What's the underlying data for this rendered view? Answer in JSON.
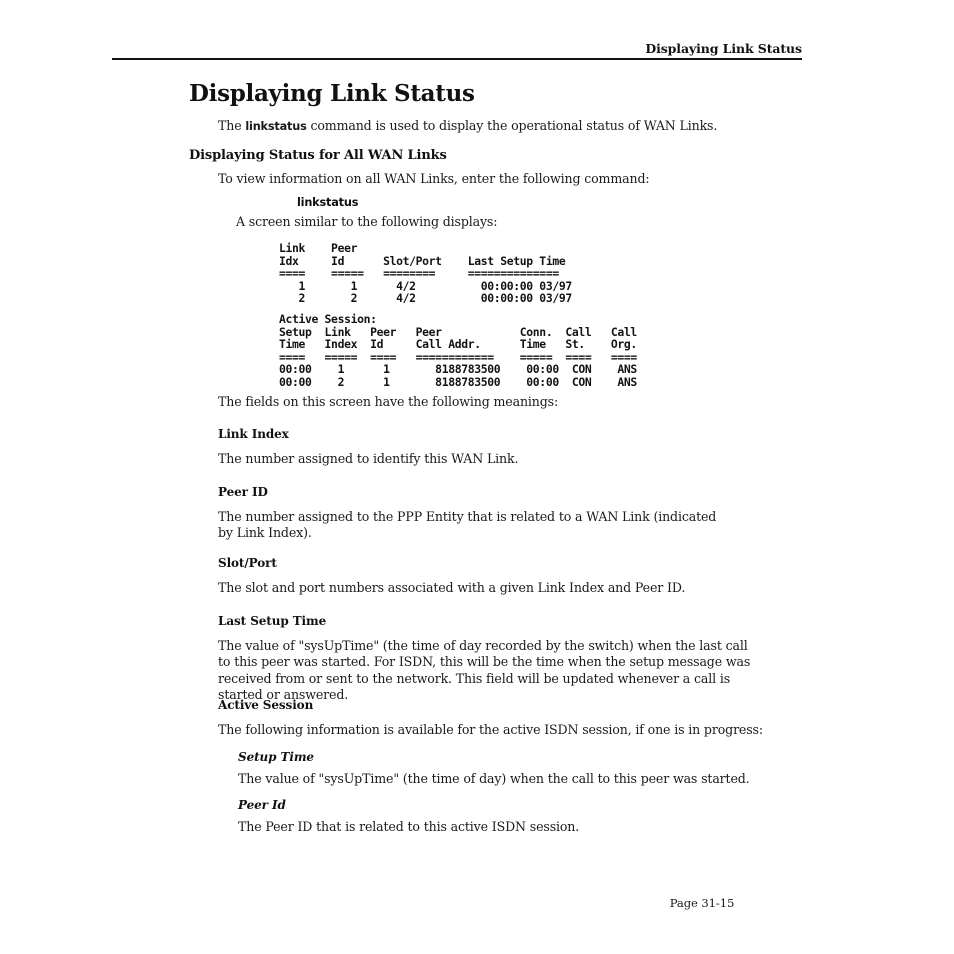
{
  "header": {
    "running_title": "Displaying Link Status"
  },
  "footer": {
    "page_number": "Page 31-15"
  },
  "main": {
    "title": "Displaying Link Status",
    "intro_before_code": "The ",
    "intro_code": "linkstatus",
    "intro_after_code": " command is used to display the operational status of WAN Links.",
    "section_all_links": {
      "heading": "Displaying Status for All WAN Links",
      "instruction": "To view information on all WAN Links, enter the following command:",
      "command": "linkstatus",
      "screen_lead_in": "A screen similar to the following displays:",
      "after_screen": "The fields on this screen have the following meanings:"
    },
    "screen_links_table": {
      "header_line_1": "Link    Peer",
      "header_line_2": "Idx     Id      Slot/Port    Last Setup Time",
      "separator": "====    =====   ========     ==============",
      "rows": [
        "   1       1      4/2          00:00:00 03/97",
        "   2       2      4/2          00:00:00 03/97"
      ]
    },
    "screen_active_session": {
      "label": "Active Session:",
      "header_line_1": "Setup  Link   Peer   Peer            Conn.  Call   Call",
      "header_line_2": "Time   Index  Id     Call Addr.      Time   St.    Org.",
      "separator": "====   =====  ====   ============    =====  ====   ====",
      "rows": [
        "00:00    1      1       8188783500    00:00  CON    ANS",
        "00:00    2      1       8188783500    00:00  CON    ANS"
      ]
    },
    "definitions": [
      {
        "term": "Link Index",
        "text": "The number assigned to identify this WAN Link."
      },
      {
        "term": "Peer ID",
        "text": "The number assigned to the PPP Entity that is related to a WAN Link (indicated by Link Index)."
      },
      {
        "term": "Slot/Port",
        "text": "The slot and port numbers associated with a given Link Index and Peer ID."
      },
      {
        "term": "Last Setup Time",
        "text": "The value of \"sysUpTime\" (the time of day recorded by the switch) when the last call to this peer was started. For ISDN, this will be the time when the setup message was received from or sent to the network. This field will be updated whenever a call is started or answered."
      },
      {
        "term": "Active Session",
        "text": "The following information is available for the active ISDN session, if one is in progress:"
      }
    ],
    "sub_definitions": [
      {
        "term": "Setup Time",
        "text": "The value of \"sysUpTime\" (the time of day) when the call to this peer was started."
      },
      {
        "term": "Peer Id",
        "text": "The Peer ID that is related to this active ISDN session."
      }
    ]
  }
}
